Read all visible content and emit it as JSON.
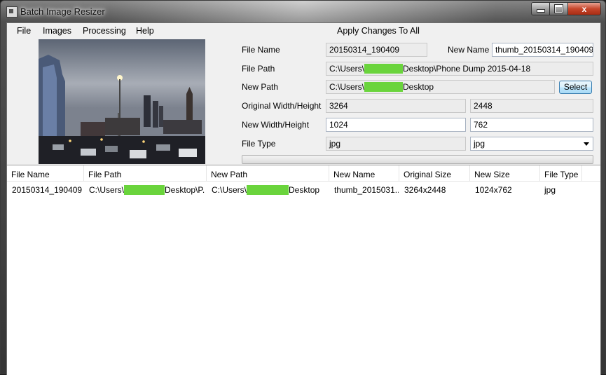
{
  "window": {
    "title": "Batch Image Resizer",
    "controls": {
      "minimize": "minimize-icon",
      "maximize": "maximize-icon",
      "close": "close-icon",
      "close_glyph": "x"
    }
  },
  "menu": {
    "items": [
      "File",
      "Images",
      "Processing",
      "Help"
    ],
    "apply_all": "Apply Changes To All"
  },
  "details": {
    "file_name_label": "File Name",
    "file_name": "20150314_190409",
    "new_name_label": "New Name",
    "new_name": "thumb_20150314_190409",
    "file_path_label": "File Path",
    "file_path_prefix": "C:\\Users\\",
    "file_path_suffix": "Desktop\\Phone Dump 2015-04-18",
    "new_path_label": "New Path",
    "new_path_prefix": "C:\\Users\\",
    "new_path_suffix": "Desktop",
    "select_label": "Select",
    "original_wh_label": "Original Width/Height",
    "original_width": "3264",
    "original_height": "2448",
    "new_wh_label": "New Width/Height",
    "new_width": "1024",
    "new_height": "762",
    "file_type_label": "File Type",
    "file_type": "jpg",
    "new_file_type": "jpg",
    "progress": 0
  },
  "table": {
    "columns": [
      "File Name",
      "File Path",
      "New Path",
      "New Name",
      "Original Size",
      "New Size",
      "File Type"
    ],
    "rows": [
      {
        "file_name": "20150314_190409",
        "file_path_prefix": "C:\\Users\\",
        "file_path_suffix": "Desktop\\P...",
        "new_path_prefix": "C:\\Users\\",
        "new_path_suffix": "Desktop",
        "new_name": "thumb_2015031...",
        "original_size": "3264x2448",
        "new_size": "1024x762",
        "file_type": "jpg"
      }
    ]
  },
  "colors": {
    "redaction": "#6ad43c",
    "progress": "#06b025",
    "close_button": "#c7462b"
  }
}
